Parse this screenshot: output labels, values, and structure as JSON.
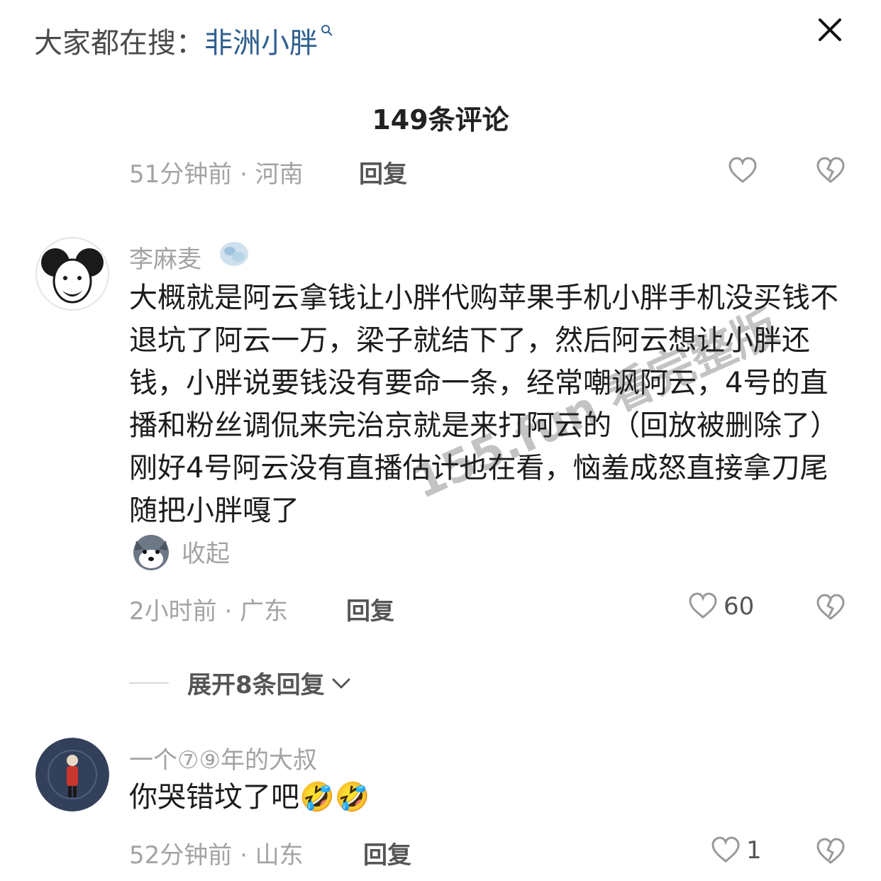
{
  "topbar": {
    "search_prefix": "大家都在搜：",
    "search_term": "非洲小胖",
    "search_icon": "search-icon",
    "close_icon": "close-icon"
  },
  "comments_header": {
    "count_label": "149条评论"
  },
  "comment_0": {
    "time_location": "51分钟前 · 河南",
    "reply_label": "回复"
  },
  "comment_1": {
    "username": "李麻麦",
    "body": "大概就是阿云拿钱让小胖代购苹果手机小胖手机没买钱不退坑了阿云一万，梁子就结下了，然后阿云想让小胖还钱，小胖说要钱没有要命一条，经常嘲讽阿云，4号的直播和粉丝调侃来完治京就是来打阿云的（回放被删除了）刚好4号阿云没有直播估计也在看，恼羞成怒直接拿刀尾随把小胖嘎了",
    "collapse_label": "收起",
    "time_location": "2小时前 · 广东",
    "reply_label": "回复",
    "like_count": "60"
  },
  "expand_replies": {
    "label": "展开8条回复"
  },
  "comment_2": {
    "username": "一个⑦⑨年的大叔",
    "body": "你哭错坟了吧",
    "emojis": [
      "🤣",
      "🤣"
    ],
    "time_location": "52分钟前 · 山东",
    "reply_label": "回复",
    "like_count": "1"
  },
  "watermark": {
    "text": "155.fun 看完整版"
  },
  "colors": {
    "accent": "#2f5f8f",
    "meta": "#a3a3a3",
    "text": "#1c1c1c"
  }
}
